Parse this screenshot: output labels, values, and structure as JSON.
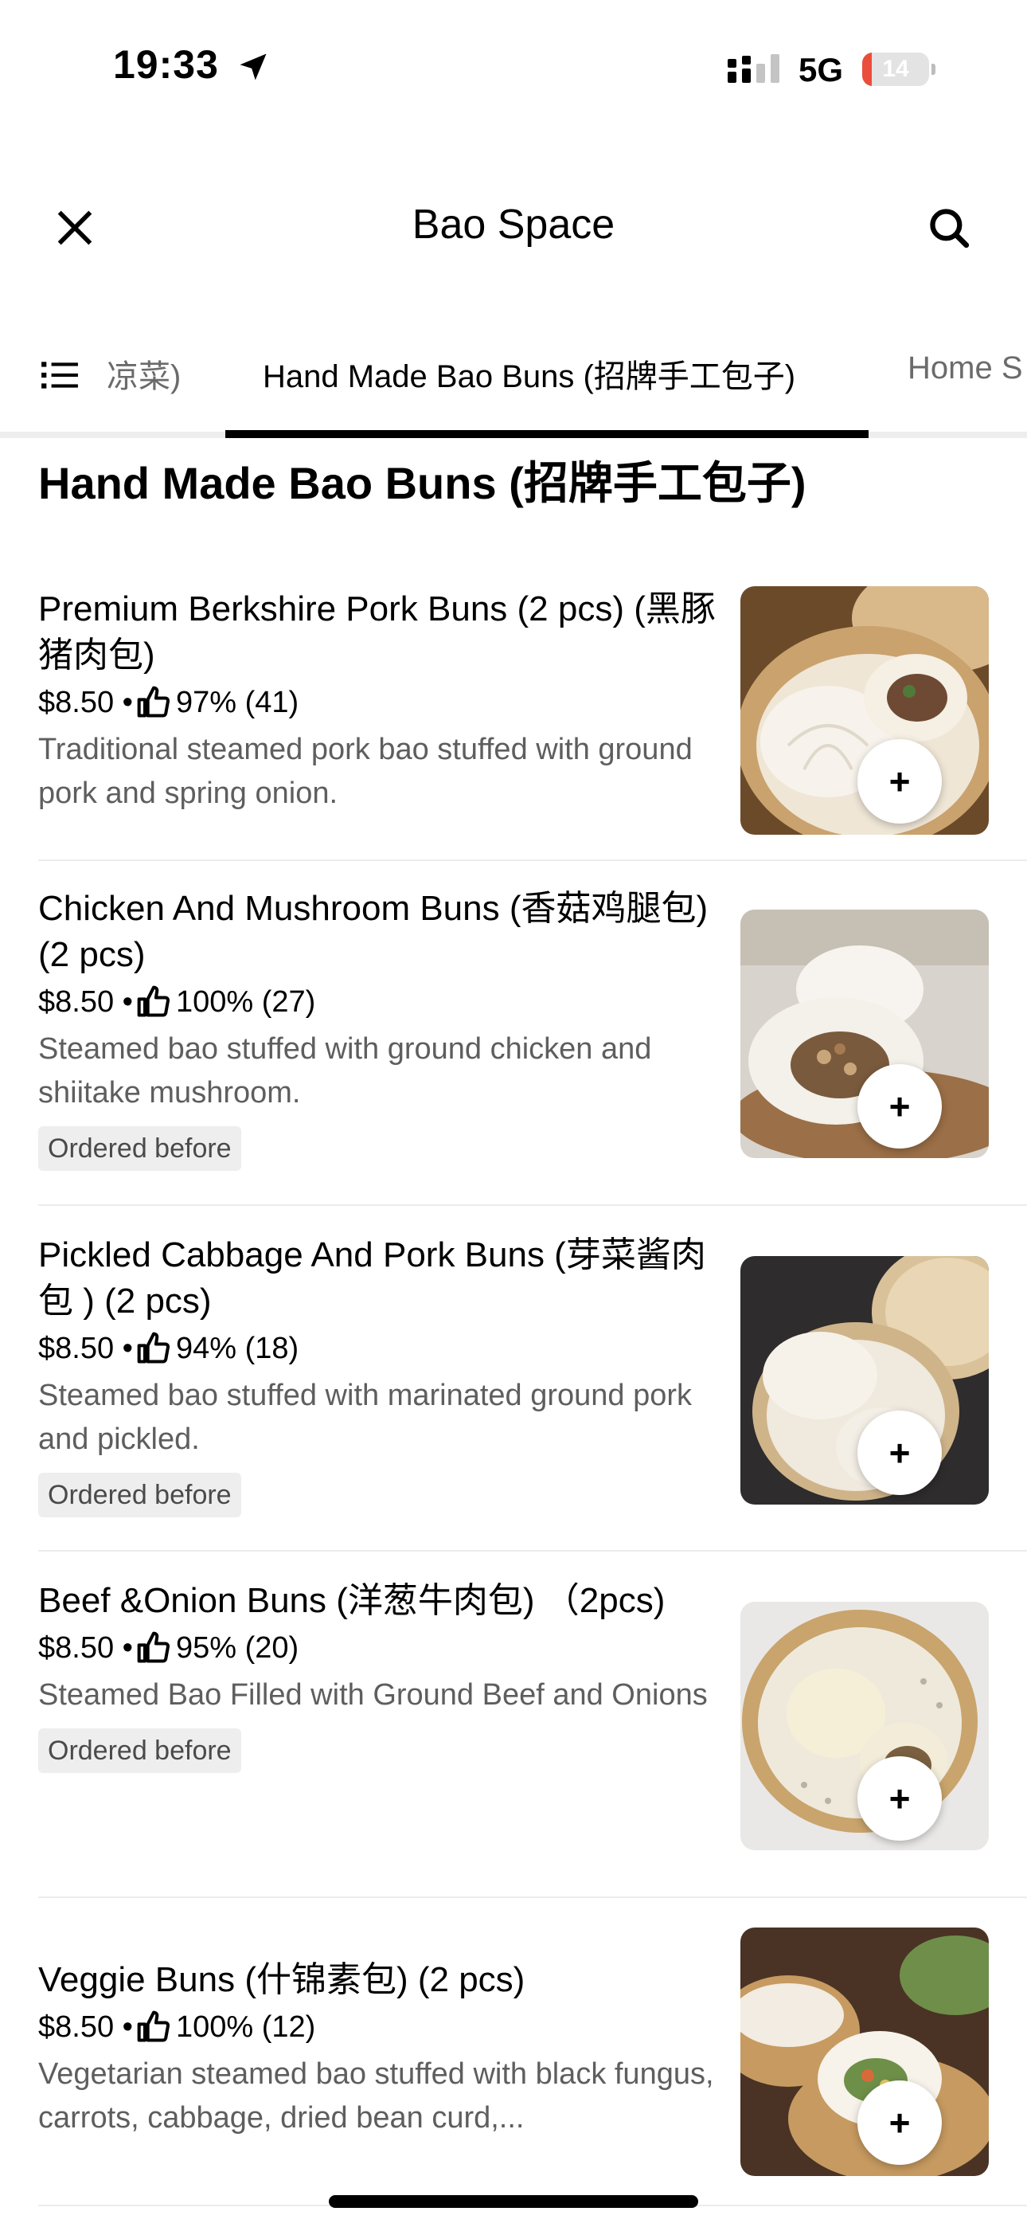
{
  "status_bar": {
    "time": "19:33",
    "network": "5G",
    "battery": "14",
    "battery_level_percent": 14
  },
  "header": {
    "title": "Bao Space",
    "close_icon": "close-icon",
    "search_icon": "search-icon"
  },
  "tabs": {
    "menu_icon": "list-icon",
    "items": [
      {
        "label": "凉菜)"
      },
      {
        "label": "Hand Made Bao Buns (招牌手工包子)"
      },
      {
        "label": "Home S"
      }
    ]
  },
  "section": {
    "title": "Hand Made Bao Buns (招牌手工包子)"
  },
  "menu_items": [
    {
      "name": "Premium Berkshire Pork Buns (2 pcs) (黑豚猪肉包)",
      "price": "$8.50 •",
      "rating": "97% (41)",
      "description": "Traditional steamed pork bao stuffed with ground pork and spring onion.",
      "badge": ""
    },
    {
      "name": "Chicken And Mushroom Buns (香菇鸡腿包) (2 pcs)",
      "price": "$8.50 •",
      "rating": "100% (27)",
      "description": "Steamed bao stuffed with ground chicken and shiitake mushroom.",
      "badge": "Ordered before"
    },
    {
      "name": "Pickled Cabbage And Pork Buns (芽菜酱肉包 ) (2 pcs)",
      "price": "$8.50 •",
      "rating": "94% (18)",
      "description": "Steamed bao stuffed with marinated ground pork and pickled.",
      "badge": "Ordered before"
    },
    {
      "name": "Beef &Onion Buns (洋葱牛肉包) （2pcs)",
      "price": "$8.50 •",
      "rating": "95% (20)",
      "description": "Steamed Bao Filled with Ground Beef and Onions",
      "badge": "Ordered before"
    },
    {
      "name": "Veggie Buns (什锦素包) (2 pcs)",
      "price": "$8.50 •",
      "rating": "100% (12)",
      "description": "Vegetarian steamed bao stuffed with black fungus, carrots, cabbage, dried bean curd,...",
      "badge": ""
    }
  ],
  "add_button_label": "+"
}
